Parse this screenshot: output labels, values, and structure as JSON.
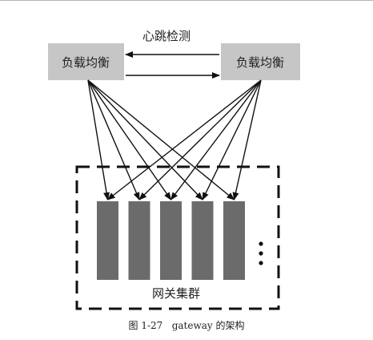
{
  "diagram": {
    "load_balancers": [
      {
        "label": "负载均衡"
      },
      {
        "label": "负载均衡"
      }
    ],
    "heartbeat_label": "心跳检测",
    "gateway_cluster": {
      "label": "网关集群",
      "node_count": 5,
      "more_indicator": "⋮"
    },
    "caption": "图 1-27   gateway 的架构",
    "colors": {
      "balancer_fill": "#c6c6c6",
      "gateway_node_fill": "#6b6b6b",
      "line": "#111111",
      "text": "#222222"
    }
  }
}
